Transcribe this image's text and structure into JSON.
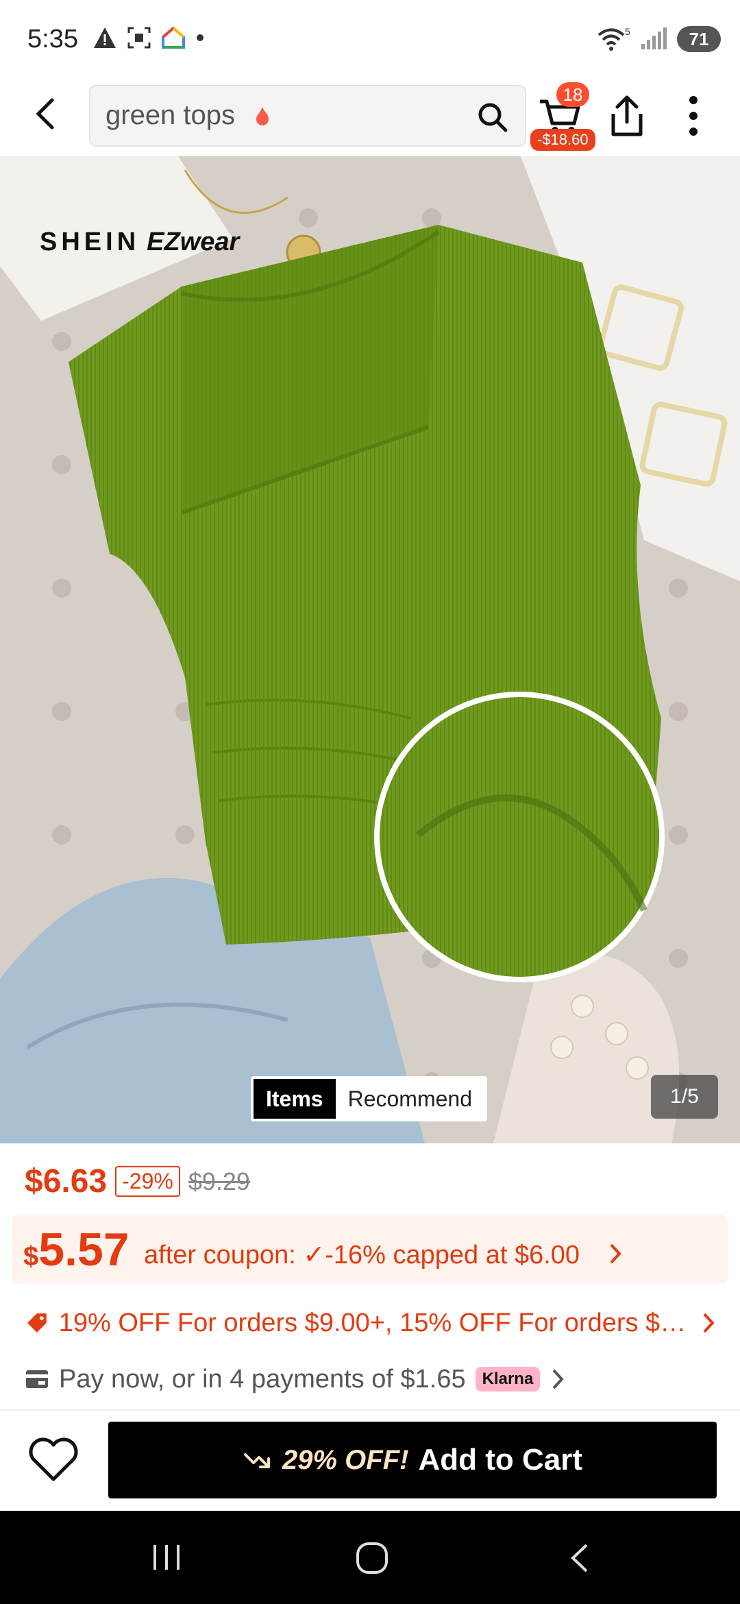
{
  "status_bar": {
    "time": "5:35",
    "network": "5",
    "battery": "71"
  },
  "header": {
    "search_value": "green tops",
    "cart_count": "18",
    "cart_saving": "-$18.60"
  },
  "product": {
    "brand_main": "SHEIN",
    "brand_sub": "EZwear",
    "tabs": [
      {
        "label": "Items",
        "active": true
      },
      {
        "label": "Recommend",
        "active": false
      }
    ],
    "image_index": "1/5"
  },
  "pricing": {
    "price": "$6.63",
    "discount": "-29%",
    "original_price": "$9.29",
    "coupon_currency": "$",
    "coupon_price": "5.57",
    "coupon_text": "after coupon: ✓-16% capped at $6.00",
    "promo_text": "19% OFF For orders $9.00+,  15% OFF For orders $9...",
    "pay_text": "Pay now, or in 4 payments of $1.65",
    "klarna_label": "Klarna"
  },
  "action_bar": {
    "off_label": "29% OFF!",
    "add_to_cart_label": "Add to Cart"
  },
  "colors": {
    "accent": "#e23c10",
    "badge": "#ff4d2e",
    "product_green": "#6f9a1e"
  }
}
